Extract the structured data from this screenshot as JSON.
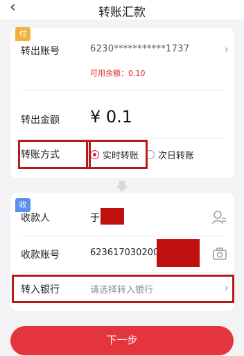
{
  "header": {
    "title": "转账汇款",
    "back_icon": "chevron-left-icon"
  },
  "payer": {
    "badge": "付",
    "account_label": "转出账号",
    "account_number": "6230***********1737",
    "available_balance": "可用余额：0.10",
    "amount_label": "转出金额",
    "amount": "¥ 0.1",
    "method_label": "转账方式",
    "methods": [
      {
        "label": "实时转账",
        "selected": true
      },
      {
        "label": "次日转账",
        "selected": false
      }
    ]
  },
  "payee": {
    "badge": "收",
    "name_label": "收款人",
    "name_prefix": "于",
    "account_label": "收款账号",
    "account_number": "623617030200",
    "bank_label": "转入银行",
    "bank_placeholder": "请选择转入银行"
  },
  "actions": {
    "next_label": "下一步"
  },
  "colors": {
    "accent_red": "#e4343c",
    "highlight_border": "#b51b1b",
    "redaction": "#c01010",
    "pay_badge": "#f0b23a",
    "recv_badge": "#5b8ff0"
  }
}
